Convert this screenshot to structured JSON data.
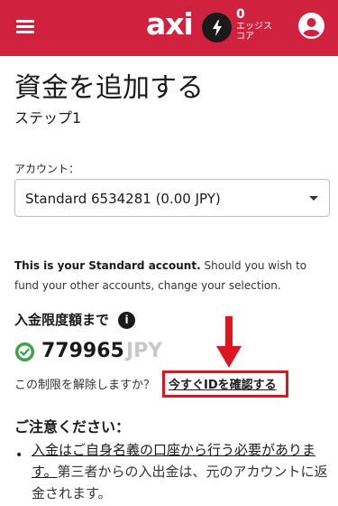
{
  "header": {
    "brand": "axi",
    "edge_count": "0",
    "edge_label": "エッジスコア",
    "colors": {
      "bar": "#d0213f",
      "bolt_bg": "#1a1a1a"
    },
    "icons": {
      "menu": "hamburger-menu-icon",
      "bolt": "lightning-bolt-icon",
      "profile": "user-avatar-icon"
    }
  },
  "page": {
    "title": "資金を追加する",
    "step": "ステップ1"
  },
  "account": {
    "label": "アカウント：",
    "selected": "Standard 6534281 (0.00 JPY)"
  },
  "info": {
    "bold": "This is your Standard account.",
    "rest": " Should you wish to fund your other accounts, change your selection."
  },
  "deposit_limit": {
    "title": "入金限度額まで",
    "info_icon": "i",
    "amount": "779965",
    "currency": "JPY",
    "status_color": "#3fa34d"
  },
  "verify": {
    "question": "この制限を解除しますか？",
    "link": "今すぐIDを確認する",
    "highlight_color": "#e0141e"
  },
  "caution": {
    "title": "ご注意ください：",
    "bullet": "•",
    "underlined": "入金はご自身名義の口座から行う必要があります。",
    "rest": "第三者からの入出金は、元のアカウントに返金されます。"
  }
}
